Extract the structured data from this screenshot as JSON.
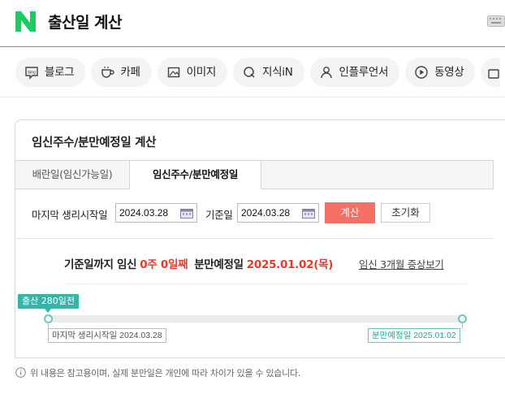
{
  "header": {
    "title": "출산일 계산"
  },
  "chips": [
    {
      "label": "블로그",
      "icon": "blog-icon"
    },
    {
      "label": "카페",
      "icon": "cafe-cup-icon"
    },
    {
      "label": "이미지",
      "icon": "image-icon"
    },
    {
      "label": "지식iN",
      "icon": "knowledge-q-icon"
    },
    {
      "label": "인플루언서",
      "icon": "person-icon"
    },
    {
      "label": "동영상",
      "icon": "play-icon"
    }
  ],
  "card": {
    "title": "임신주수/분만예정일 계산",
    "tabs": [
      {
        "label": "배란일(임신가능일)",
        "active": false
      },
      {
        "label": "임신주수/분만예정일",
        "active": true
      }
    ],
    "form": {
      "lmp_label": "마지막 생리시작일",
      "lmp_value": "2024.03.28",
      "base_label": "기준일",
      "base_value": "2024.03.28",
      "calc_button": "계산",
      "reset_button": "초기화"
    },
    "result": {
      "prefix": "기준일까지 임신",
      "weeks": "0주 0일째",
      "due_label": "분만예정일",
      "due_value": "2025.01.02(목)",
      "link": "임신 3개월 증상보기"
    },
    "timeline": {
      "birth_tag": "출산 280일전",
      "progress": 0,
      "start_label": "마지막 생리시작일 2024.03.28",
      "end_label": "분만예정일 2025.01.02"
    }
  },
  "note": "위 내용은 참고용이며, 실제 분만일은 개인에 따라 차이가 있을 수 있습니다.",
  "colors": {
    "brand_green": "#19ce60",
    "calc_red": "#f47067",
    "result_red": "#e33b2e",
    "timeline_teal": "#35b4aa"
  }
}
